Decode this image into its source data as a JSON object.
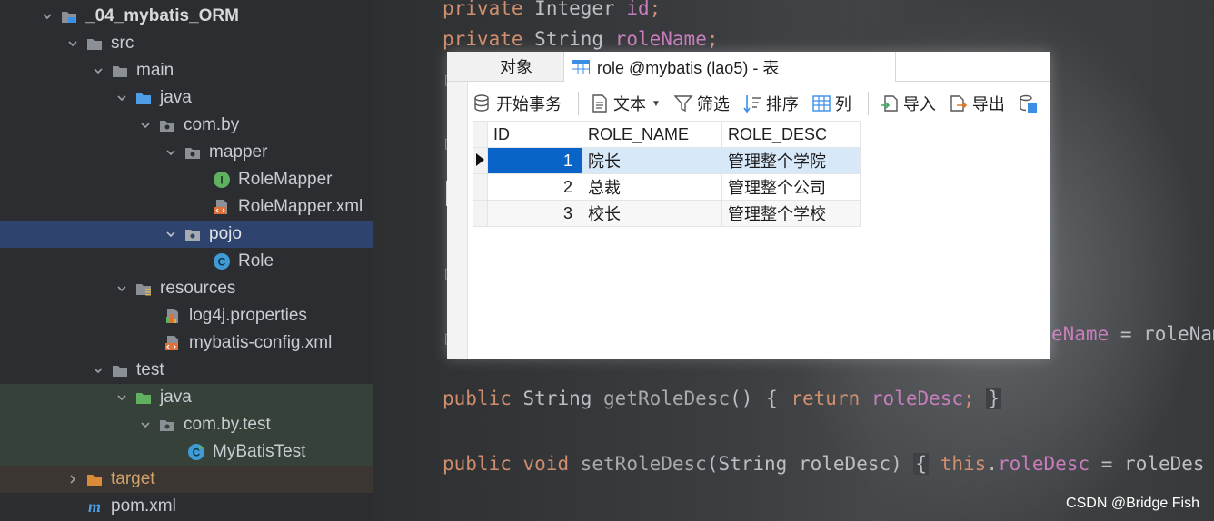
{
  "project_tree": {
    "items": [
      {
        "label": "_04_mybatis_ORM",
        "icon": "module-folder-icon",
        "expanded": true
      },
      {
        "label": "src",
        "icon": "folder-icon",
        "expanded": true
      },
      {
        "label": "main",
        "icon": "folder-icon",
        "expanded": true
      },
      {
        "label": "java",
        "icon": "source-folder-icon",
        "expanded": true
      },
      {
        "label": "com.by",
        "icon": "package-icon",
        "expanded": true
      },
      {
        "label": "mapper",
        "icon": "package-icon",
        "expanded": true
      },
      {
        "label": "RoleMapper",
        "icon": "interface-icon"
      },
      {
        "label": "RoleMapper.xml",
        "icon": "xml-file-icon"
      },
      {
        "label": "pojo",
        "icon": "package-icon",
        "expanded": true,
        "selected": true
      },
      {
        "label": "Role",
        "icon": "class-icon"
      },
      {
        "label": "resources",
        "icon": "resources-folder-icon",
        "expanded": true
      },
      {
        "label": "log4j.properties",
        "icon": "properties-file-icon"
      },
      {
        "label": "mybatis-config.xml",
        "icon": "xml-file-icon"
      },
      {
        "label": "test",
        "icon": "folder-icon",
        "expanded": true
      },
      {
        "label": "java",
        "icon": "test-source-folder-icon",
        "expanded": true
      },
      {
        "label": "com.by.test",
        "icon": "package-icon",
        "expanded": true
      },
      {
        "label": "MyBatisTest",
        "icon": "test-class-icon"
      },
      {
        "label": "target",
        "icon": "excluded-folder-icon",
        "expanded": false
      },
      {
        "label": "pom.xml",
        "icon": "maven-icon"
      }
    ]
  },
  "editor": {
    "line1": {
      "kw": "private",
      "type": "Integer",
      "field": "id",
      "end": ";"
    },
    "line2": {
      "kw": "private",
      "type": "String",
      "field": "roleName",
      "end": ";"
    },
    "line3": {
      "pre": "eName",
      "post": " = roleNam"
    },
    "line4": {
      "kw": "public",
      "type": "String",
      "method": "getRoleDesc",
      "paren": "()",
      "open": "{",
      "ret": "return",
      "field": "roleDesc",
      "end": ";",
      "close": "}"
    },
    "line5": {
      "kw": "public",
      "void": "void",
      "method": "setRoleDesc",
      "args": "(String roleDesc)",
      "open": "{",
      "this": "this",
      "dot": ".",
      "field": "roleDesc",
      "post": " = roleDes"
    }
  },
  "navicat": {
    "tabs": {
      "objects": "对象",
      "table": "role @mybatis (lao5) - 表"
    },
    "toolbar": {
      "begin_transaction": "开始事务",
      "text": "文本",
      "filter": "筛选",
      "sort": "排序",
      "columns": "列",
      "import": "导入",
      "export": "导出"
    },
    "grid": {
      "columns": [
        "ID",
        "ROLE_NAME",
        "ROLE_DESC"
      ],
      "rows": [
        {
          "id": "1",
          "name": "院长",
          "desc": "管理整个学院"
        },
        {
          "id": "2",
          "name": "总裁",
          "desc": "管理整个公司"
        },
        {
          "id": "3",
          "name": "校长",
          "desc": "管理整个学校"
        }
      ]
    }
  },
  "watermark": "CSDN @Bridge Fish",
  "colors": {
    "tree_bg": "#2b2d30",
    "tree_selected": "#2e436e",
    "keyword": "#cf8e6d",
    "field": "#c77dbb",
    "grid_selected": "#0a64c8"
  }
}
